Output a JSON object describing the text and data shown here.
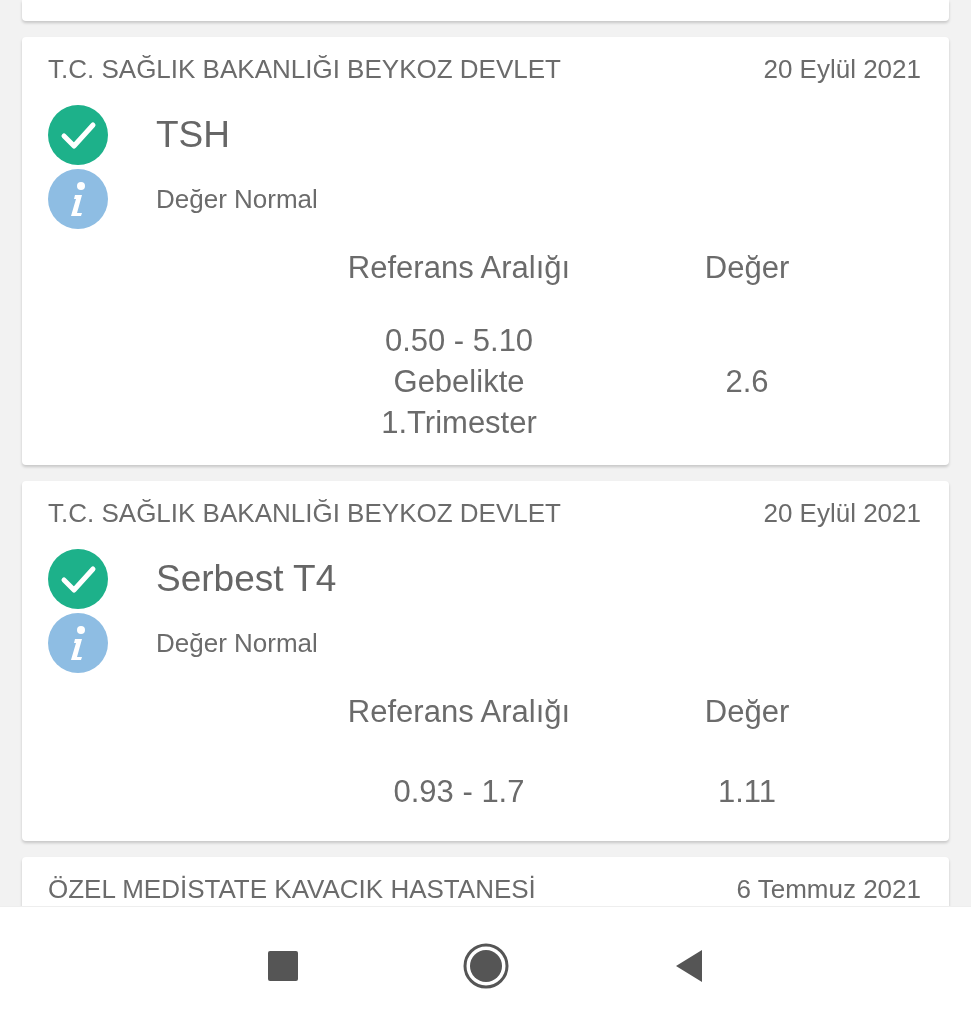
{
  "results": [
    {
      "hospital": "T.C. SAĞLIK BAKANLIĞI BEYKOZ DEVLET",
      "date": "20 Eylül 2021",
      "normal": true,
      "test": "TSH",
      "note": "Değer Normal",
      "range_heading": "Referans Aralığı",
      "value_heading": "Değer",
      "range": [
        "0.50 - 5.10",
        "Gebelikte",
        "1.Trimester"
      ],
      "value": "2.6"
    },
    {
      "hospital": "T.C. SAĞLIK BAKANLIĞI BEYKOZ DEVLET",
      "date": "20 Eylül 2021",
      "normal": true,
      "test": "Serbest T4",
      "note": "Değer Normal",
      "range_heading": "Referans Aralığı",
      "value_heading": "Değer",
      "range": [
        "0.93 - 1.7"
      ],
      "value": "1.11"
    },
    {
      "hospital": "ÖZEL MEDİSTATE KAVACIK HASTANESİ",
      "date": "6 Temmuz 2021"
    }
  ]
}
